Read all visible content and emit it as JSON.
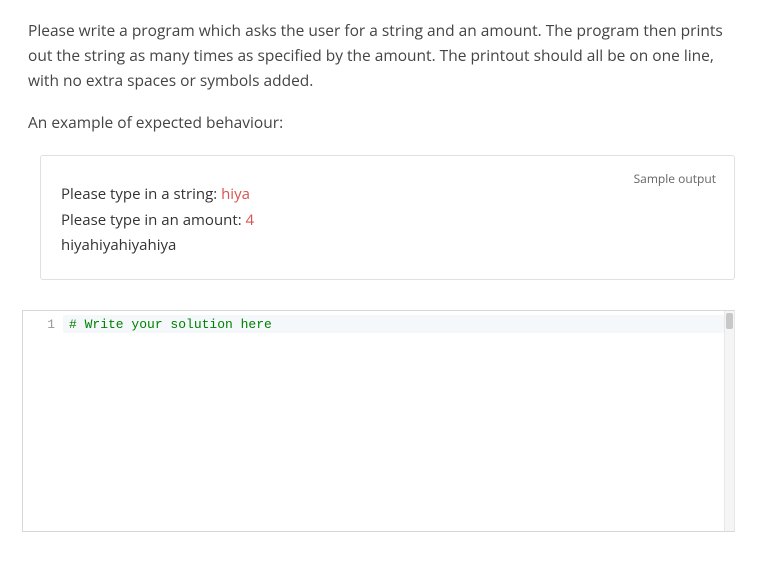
{
  "instructions": "Please write a program which asks the user for a string and an amount. The program then prints out the string as many times as specified by the amount. The printout should all be on one line, with no extra spaces or symbols added.",
  "example_intro": "An example of expected behaviour:",
  "sample": {
    "label": "Sample output",
    "lines": [
      {
        "prompt": "Please type in a string: ",
        "input": "hiya"
      },
      {
        "prompt": "Please type in an amount: ",
        "input": "4"
      },
      {
        "prompt": "hiyahiyahiyahiya",
        "input": ""
      }
    ]
  },
  "editor": {
    "line_number": "1",
    "code_comment": "# Write your solution here"
  }
}
